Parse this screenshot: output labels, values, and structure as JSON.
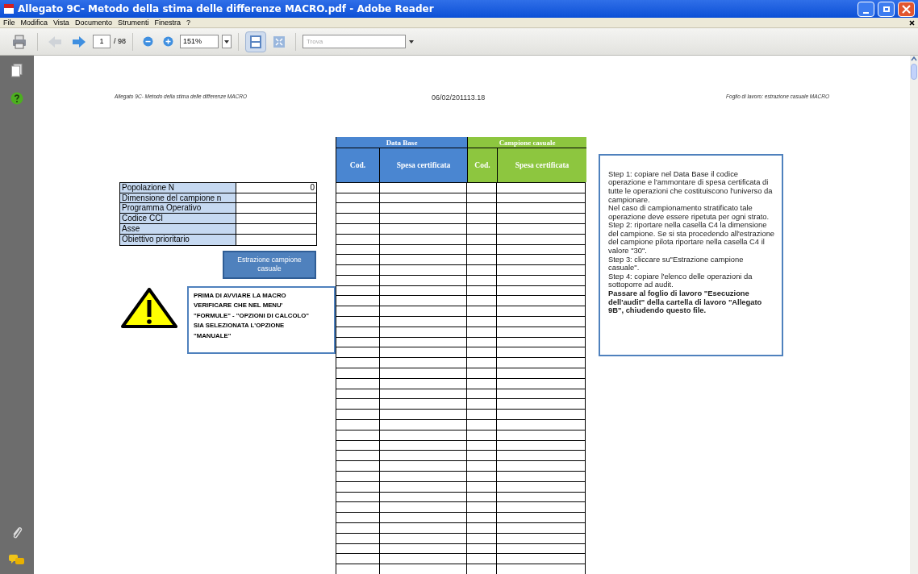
{
  "window": {
    "title": "Allegato 9C- Metodo della stima delle differenze MACRO.pdf - Adobe Reader"
  },
  "menu": [
    "File",
    "Modifica",
    "Vista",
    "Documento",
    "Strumenti",
    "Finestra",
    "?"
  ],
  "toolbar": {
    "back_disabled": true,
    "forward_disabled": false,
    "page": "1",
    "page_count": "/ 98",
    "zoom": "151%",
    "fit_page_selected": true,
    "search_placeholder": "Trova"
  },
  "document": {
    "header_left": "Allegato 9C- Metodo della stima delle differenze MACRO",
    "header_center": "06/02/201113.18",
    "header_right": "Foglio di lavoro: estrazione casuale MACRO",
    "info_rows": [
      {
        "label": "Popolazione N",
        "value": "0"
      },
      {
        "label": "Dimensione del campione n"
      },
      {
        "label": "Programma Operativo"
      },
      {
        "label": "Codice CCI"
      },
      {
        "label": "Asse"
      },
      {
        "label": "Obiettivo prioritario"
      }
    ],
    "macro_button": "Estrazione campione casuale",
    "warning_lines": [
      "PRIMA DI AVVIARE LA MACRO",
      "VERIFICARE CHE NEL MENU'",
      "\"FORMULE\"  - \"OPZIONI DI CALCOLO\"",
      "SIA SELEZIONATA L'OPZIONE",
      "\"MANUALE\""
    ],
    "table_groups": [
      {
        "title": "Data Base",
        "color": "#4a86d1",
        "columns": [
          "Cod.",
          "Spesa certificata"
        ]
      },
      {
        "title": "Campione casuale",
        "color": "#8dc63f",
        "columns": [
          "Cod.",
          "Spesa certificata"
        ]
      }
    ],
    "steps": [
      {
        "text": "Step 1: copiare nel Data Base il codice operazione e l'ammontare di spesa certificata di tutte le operazioni che costituiscono l'universo da campionare.",
        "bold": false
      },
      {
        "text": "Nel caso di campionamento stratificato tale operazione deve essere ripetuta per ogni strato.",
        "bold": false
      },
      {
        "text": "Step 2: riportare nella casella C4 la dimensione del campione. Se si sta procedendo all'estrazione del campione pilota riportare nella casella C4 il valore \"30\".",
        "bold": false
      },
      {
        "text": "Step 3: cliccare su\"Estrazione campione casuale\".",
        "bold": false
      },
      {
        "text": "Step 4: copiare l'elenco delle operazioni da sottoporre ad audit.",
        "bold": false
      },
      {
        "text": "Passare al foglio di lavoro \"Esecuzione dell'audit\" della cartella di lavoro \"Allegato 9B\", chiudendo questo file.",
        "bold": true
      }
    ]
  }
}
